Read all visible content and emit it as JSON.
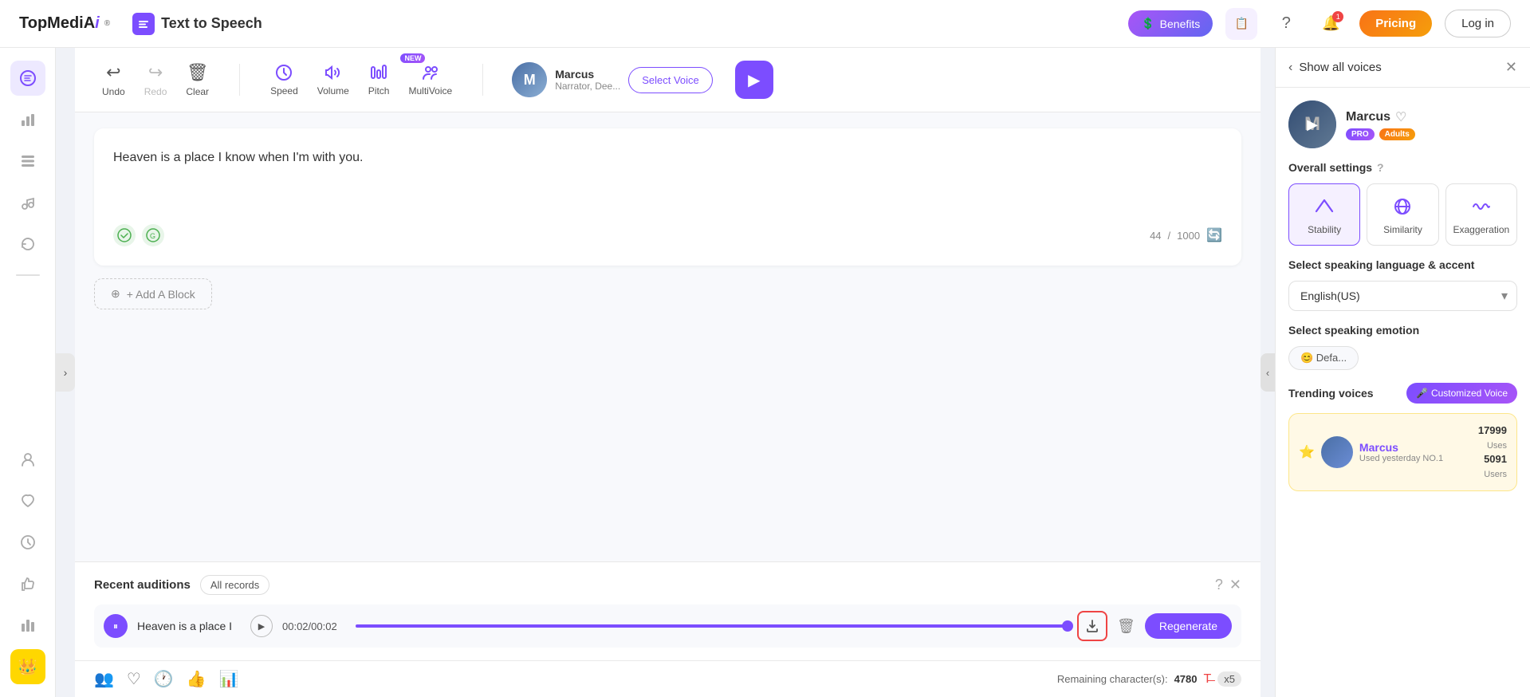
{
  "app": {
    "brand": "TopMediAi",
    "brand_tm": "®",
    "app_title": "Text to Speech"
  },
  "nav": {
    "benefits_label": "Benefits",
    "pricing_label": "Pricing",
    "login_label": "Log in",
    "bell_count": "1"
  },
  "toolbar": {
    "undo_label": "Undo",
    "redo_label": "Redo",
    "clear_label": "Clear",
    "speed_label": "Speed",
    "volume_label": "Volume",
    "pitch_label": "Pitch",
    "multivoice_label": "MultiVoice",
    "multivoice_badge": "NEW",
    "voice_name": "Marcus",
    "voice_desc": "Narrator, Dee...",
    "select_voice_label": "Select Voice"
  },
  "editor": {
    "text": "Heaven is a place I know when I'm with you.",
    "char_count": "44",
    "char_max": "1000",
    "add_block_label": "+ Add A Block"
  },
  "recent": {
    "title": "Recent auditions",
    "all_records_label": "All records",
    "audio_title": "Heaven is a place I",
    "audio_time": "00:02/00:02",
    "audio_progress_pct": 100,
    "regenerate_label": "Regenerate"
  },
  "status_bar": {
    "remaining_label": "Remaining character(s):",
    "remaining_count": "4780",
    "x_label": "x5"
  },
  "right_panel": {
    "back_label": "Show all voices",
    "voice_name": "Marcus",
    "badge_pro": "PRO",
    "badge_adults": "Adults",
    "overall_settings_label": "Overall settings",
    "stability_label": "Stability",
    "similarity_label": "Similarity",
    "exaggeration_label": "Exaggeration",
    "language_label": "Select speaking language & accent",
    "language_value": "English(US)",
    "emotion_label": "Select speaking emotion",
    "emotion_value": "😊 Defa...",
    "trending_label": "Trending voices",
    "customized_label": "Customized Voice",
    "trending_voice_name": "Marcus",
    "trending_voice_badge": "Used yesterday NO.1",
    "trending_uses": "17999",
    "trending_uses_label": "Uses",
    "trending_users": "5091",
    "trending_users_label": "Users"
  }
}
